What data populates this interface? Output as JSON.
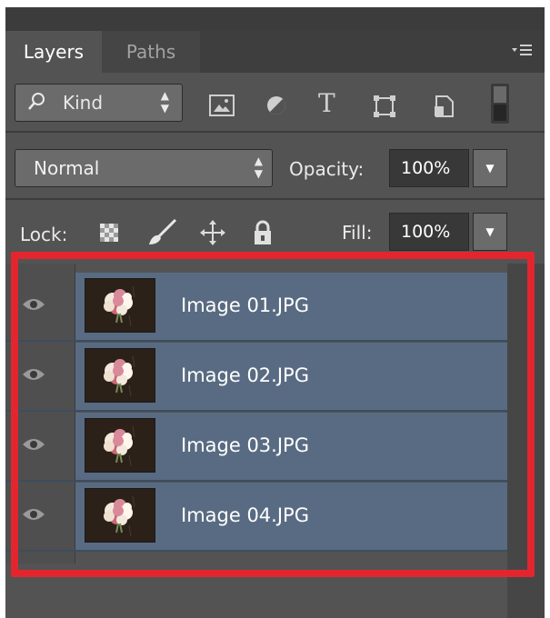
{
  "panel": {
    "tabs": [
      {
        "label": "Layers",
        "active": true
      },
      {
        "label": "Paths",
        "active": false
      }
    ],
    "menu_icon": "panel-menu-icon"
  },
  "filter": {
    "kind_label": "Kind",
    "icons": [
      "pixel-layer-filter-icon",
      "adjustment-layer-filter-icon",
      "type-layer-filter-icon",
      "shape-layer-filter-icon",
      "smart-object-filter-icon",
      "filter-toggle-icon"
    ]
  },
  "blend": {
    "mode": "Normal",
    "opacity_label": "Opacity:",
    "opacity_value": "100%"
  },
  "lock": {
    "label": "Lock:",
    "icons": [
      "lock-transparent-pixels-icon",
      "lock-image-pixels-icon",
      "lock-position-icon",
      "lock-all-icon"
    ],
    "fill_label": "Fill:",
    "fill_value": "100%"
  },
  "layers": [
    {
      "name": "Image 01.JPG",
      "visible": true,
      "selected": true
    },
    {
      "name": "Image 02.JPG",
      "visible": true,
      "selected": true
    },
    {
      "name": "Image 03.JPG",
      "visible": true,
      "selected": true
    },
    {
      "name": "Image 04.JPG",
      "visible": true,
      "selected": true
    }
  ],
  "colors": {
    "panel_bg": "#535353",
    "selected_row": "#596b82",
    "highlight": "#e3262e"
  }
}
